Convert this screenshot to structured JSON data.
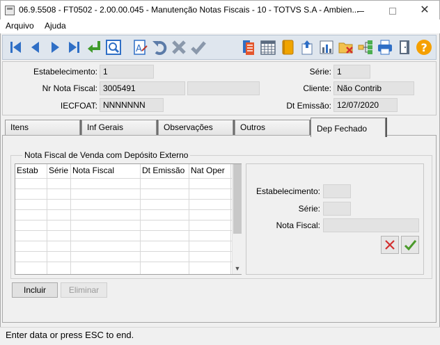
{
  "window": {
    "title": "06.9.5508 - FT0502 - 2.00.00.045 - Manutenção Notas Fiscais - 10 - TOTVS S.A - Ambien...",
    "close_glyph": "✕"
  },
  "menu": {
    "arquivo": "Arquivo",
    "ajuda": "Ajuda"
  },
  "toolbar": {
    "icons": [
      "first-icon",
      "prev-icon",
      "next-icon",
      "last-icon",
      "goto-icon",
      "search-icon",
      "edit-icon",
      "undo-icon",
      "delete-icon",
      "save-icon",
      "report-icon",
      "calendar-icon",
      "book-icon",
      "export-icon",
      "chart-icon",
      "folder-delete-icon",
      "tree-icon",
      "print-icon",
      "exit-icon",
      "help-icon"
    ]
  },
  "header": {
    "estabelecimento_label": "Estabelecimento:",
    "estabelecimento_value": "1",
    "nr_nota_label": "Nr Nota Fiscal:",
    "nr_nota_value": "3005491",
    "nr_nota_extra": "",
    "iecfoat_label": "IECFOAT:",
    "iecfoat_value": "NNNNNNN",
    "serie_label": "Série:",
    "serie_value": "1",
    "cliente_label": "Cliente:",
    "cliente_value": "Não Contrib",
    "dt_emissao_label": "Dt Emissão:",
    "dt_emissao_value": "12/07/2020"
  },
  "tabs": {
    "itens": "Itens",
    "inf_gerais": "Inf  Gerais",
    "observacoes": "Observações",
    "outros": "Outros",
    "dep_fechado": "Dep Fechado",
    "active": "Dep Fechado"
  },
  "dep_fechado": {
    "group_title": "Nota Fiscal de Venda com Depósito Externo",
    "columns": [
      "Estab",
      "Série",
      "Nota Fiscal",
      "Dt Emissão",
      "Nat Oper"
    ],
    "rows": [],
    "estabelecimento_label": "Estabelecimento:",
    "estabelecimento_value": "",
    "serie_label": "Série:",
    "serie_value": "",
    "nota_fiscal_label": "Nota Fiscal:",
    "nota_fiscal_value": "",
    "incluir": "Incluir",
    "eliminar": "Eliminar"
  },
  "status": {
    "message": "Enter data or press ESC to end."
  },
  "colors": {
    "toolbar_bg": "#dfe6ee",
    "field_bg": "#e3e3e3",
    "accent_blue": "#2f6fc6",
    "help_orange": "#f5a000"
  }
}
